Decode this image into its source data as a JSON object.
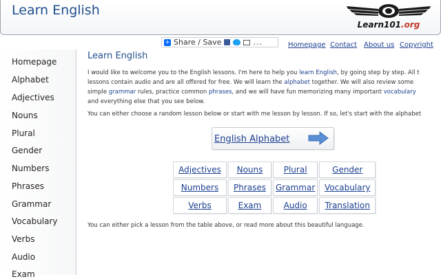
{
  "header": {
    "site_title": "Learn English",
    "logo_text": "Learn101",
    "logo_suffix": ".org"
  },
  "share": {
    "label": "Share / Save",
    "more": "..."
  },
  "topnav": [
    {
      "label": "Homepage"
    },
    {
      "label": "Contact"
    },
    {
      "label": "About us"
    },
    {
      "label": "Copyright"
    }
  ],
  "sidebar": {
    "items": [
      {
        "label": "Homepage"
      },
      {
        "label": "Alphabet"
      },
      {
        "label": "Adjectives"
      },
      {
        "label": "Nouns"
      },
      {
        "label": "Plural"
      },
      {
        "label": "Gender"
      },
      {
        "label": "Numbers"
      },
      {
        "label": "Phrases"
      },
      {
        "label": "Grammar"
      },
      {
        "label": "Vocabulary"
      },
      {
        "label": "Verbs"
      },
      {
        "label": "Audio"
      },
      {
        "label": "Exam"
      }
    ]
  },
  "main": {
    "title": "Learn English",
    "intro": {
      "l1a": "I would like to welcome you to the English lessons. I'm here to help you ",
      "l1link": "learn English",
      "l1b": ", by going step by step. All t",
      "l2a": "lessons contain audio and are all offered for free. We will learn the ",
      "l2link": "alphabet",
      "l2b": " together. We will also review some",
      "l3a": "simple ",
      "l3link1": "grammar",
      "l3b": " rules, practice common ",
      "l3link2": "phrases",
      "l3c": ", and we will have fun memorizing many important ",
      "l3link3": "vocabulary",
      "l4": "and everything else that you see below."
    },
    "choose_text": "You can either choose a random lesson below or start with me lesson by lesson. If so, let's start with the alphabet",
    "alphabet_button": "English Alphabet",
    "lessons": [
      [
        "Adjectives",
        "Nouns",
        "Plural",
        "Gender"
      ],
      [
        "Numbers",
        "Phrases",
        "Grammar",
        "Vocabulary"
      ],
      [
        "Verbs",
        "Exam",
        "Audio",
        "Translation"
      ]
    ],
    "outro": "You can either pick a lesson from the table above, or read more about this beautiful language."
  },
  "colors": {
    "link": "#1a3f8f",
    "title": "#1f4e8c",
    "arrow": "#5a8fd6",
    "logo_accent": "#c0392b"
  }
}
